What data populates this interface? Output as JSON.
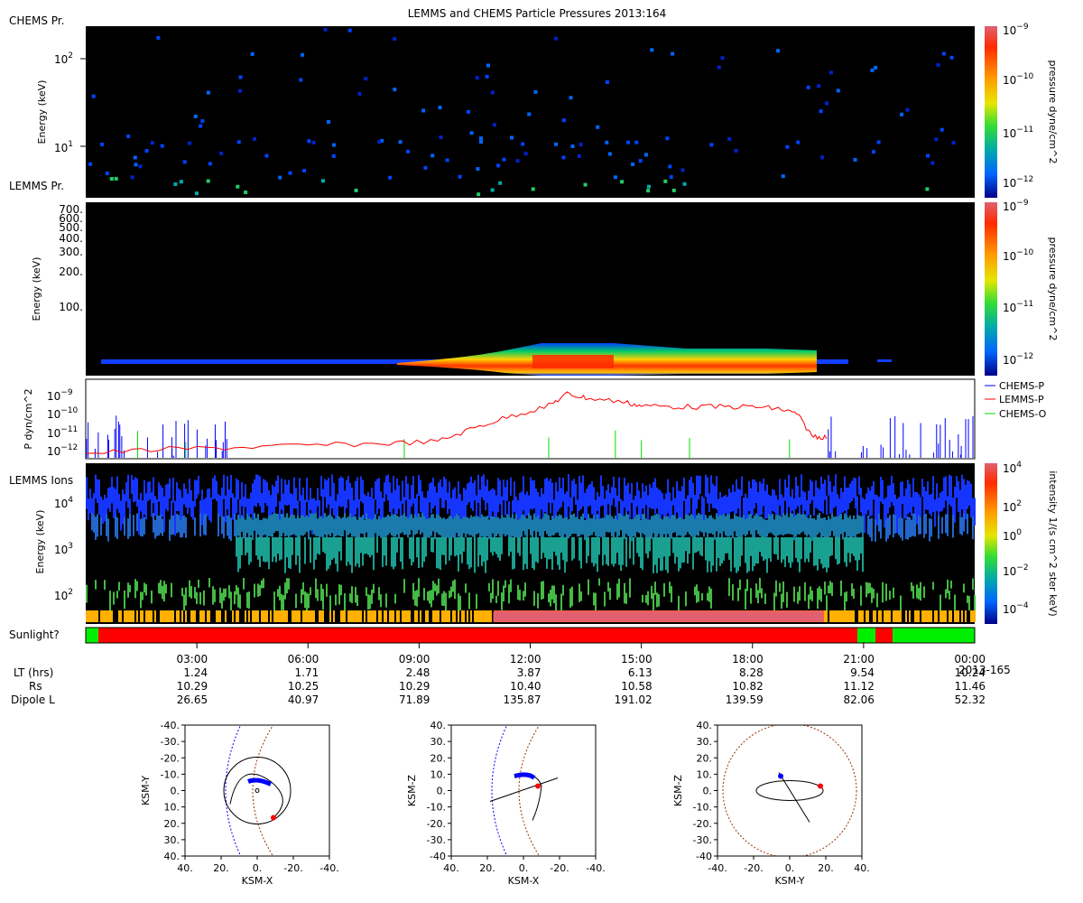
{
  "title": "LEMMS and CHEMS Particle Pressures  2013:164",
  "panel_labels": {
    "chems_pr": "CHEMS Pr.",
    "lemms_pr": "LEMMS Pr.",
    "lemms_ions": "LEMMS Ions",
    "sunlight": "Sunlight?"
  },
  "colorbar_labels": {
    "pressure": "pressure dyne/cm^2",
    "intensity": "intensity 1/(s cm^2 ster keV)"
  },
  "ephemeris": {
    "row_labels": [
      "LT (hrs)",
      "Rs",
      "Dipole L"
    ],
    "times": [
      "03:00",
      "06:00",
      "09:00",
      "12:00",
      "15:00",
      "18:00",
      "21:00",
      "00:00"
    ],
    "lt": [
      "1.24",
      "1.71",
      "2.48",
      "3.87",
      "6.13",
      "8.28",
      "9.54",
      "10.24"
    ],
    "rs": [
      "10.29",
      "10.25",
      "10.29",
      "10.40",
      "10.58",
      "10.82",
      "11.12",
      "11.46"
    ],
    "dipole_l": [
      "26.65",
      "40.97",
      "71.89",
      "135.87",
      "191.02",
      "139.59",
      "82.06",
      "52.32"
    ],
    "end_date": "2013-165"
  },
  "colors": {
    "chems_p": "#0000ff",
    "lemms_p": "#ff0000",
    "chems_o": "#00dd00",
    "sunlight_red": "#ff0000",
    "sunlight_green": "#00ee00",
    "background_panel": "#000000"
  },
  "chart_data": [
    {
      "type": "heatmap",
      "panel": "CHEMS Pr.",
      "ylabel": "Energy (keV)",
      "yscale": "log",
      "yticks": [
        "10^1",
        "10^2"
      ],
      "colorbar_ticks": [
        "10^-9",
        "10^-10",
        "10^-11",
        "10^-12"
      ],
      "colorbar_label": "pressure dyne/cm^2"
    },
    {
      "type": "heatmap",
      "panel": "LEMMS Pr.",
      "ylabel": "Energy (keV)",
      "yscale": "log",
      "yticks": [
        "700.",
        "600.",
        "500.",
        "400.",
        "300.",
        "200.",
        "100."
      ],
      "colorbar_ticks": [
        "10^-9",
        "10^-10",
        "10^-11",
        "10^-12"
      ],
      "colorbar_label": "pressure dyne/cm^2"
    },
    {
      "type": "line",
      "ylabel": "P dyn/cm^2",
      "yscale": "log",
      "yticks": [
        "10^-9",
        "10^-10",
        "10^-11",
        "10^-12"
      ],
      "x_hours": [
        0,
        2,
        4,
        6,
        8,
        9.5,
        10.5,
        11.5,
        12.5,
        13,
        13.5,
        14.5,
        15,
        16,
        17,
        18,
        18.7,
        19.2,
        19.6,
        20
      ],
      "series": [
        {
          "name": "CHEMS-P",
          "color": "#0000ff"
        },
        {
          "name": "LEMMS-P",
          "color": "#ff0000",
          "log10_values": [
            -12.1,
            -11.9,
            -11.8,
            -11.7,
            -11.6,
            -11.5,
            -10.8,
            -10.2,
            -9.7,
            -9.1,
            -9.3,
            -9.5,
            -9.7,
            -9.75,
            -9.75,
            -9.75,
            -9.85,
            -10.1,
            -11.2,
            -11.3
          ]
        },
        {
          "name": "CHEMS-O",
          "color": "#00dd00"
        }
      ]
    },
    {
      "type": "heatmap",
      "panel": "LEMMS Ions",
      "ylabel": "Energy (keV)",
      "yscale": "log",
      "yticks": [
        "10^2",
        "10^3",
        "10^4"
      ],
      "colorbar_ticks": [
        "10^4",
        "10^2",
        "10^0",
        "10^-2",
        "10^-4"
      ],
      "colorbar_label": "intensity 1/(s cm^2 ster keV)"
    },
    {
      "type": "orbit",
      "xlabel": "KSM-X",
      "ylabel": "KSM-Y",
      "xticks": [
        "40.",
        "20.",
        "0.",
        "-20.",
        "-40."
      ],
      "yticks": [
        "-40.",
        "-30.",
        "-20.",
        "-10.",
        "0.",
        "10.",
        "20.",
        "30.",
        "40."
      ]
    },
    {
      "type": "orbit",
      "xlabel": "KSM-X",
      "ylabel": "KSM-Z",
      "xticks": [
        "40.",
        "20.",
        "0.",
        "-20.",
        "-40."
      ],
      "yticks": [
        "40.",
        "30.",
        "20.",
        "10.",
        "0.",
        "-10.",
        "-20.",
        "-30.",
        "-40"
      ]
    },
    {
      "type": "orbit",
      "xlabel": "KSM-Y",
      "ylabel": "KSM-Z",
      "xticks": [
        "-40.",
        "-20.",
        "0.",
        "20.",
        "40."
      ],
      "yticks": [
        "40.",
        "30.",
        "20.",
        "10.",
        "0.",
        "-10.",
        "-20.",
        "-30.",
        "-40"
      ]
    }
  ]
}
